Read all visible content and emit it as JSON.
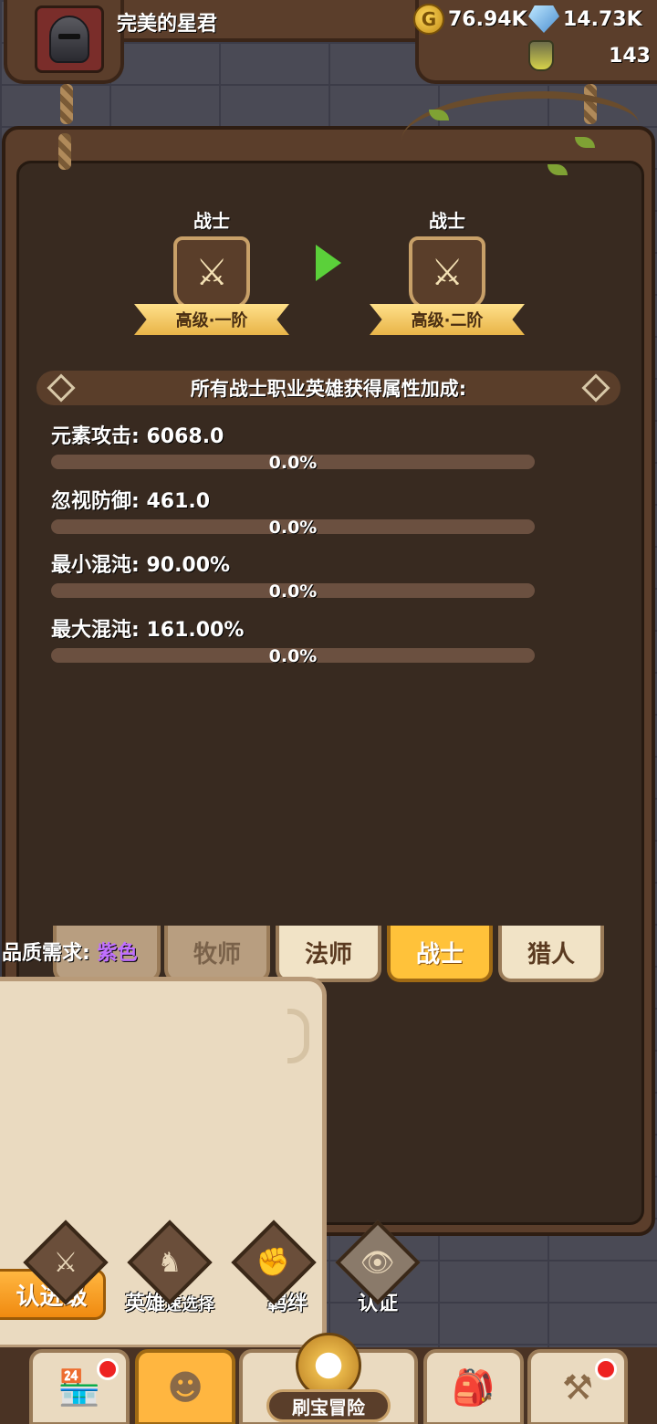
{
  "player": {
    "name": "完美的星君"
  },
  "resources": {
    "gold": "76.94K",
    "gems": "14.73K",
    "potion": "143"
  },
  "upgrade": {
    "from": {
      "class_name": "战士",
      "rank": "高级·一阶"
    },
    "to": {
      "class_name": "战士",
      "rank": "高级·二阶"
    }
  },
  "bonus": {
    "title": "所有战士职业英雄获得属性加成:",
    "stats": [
      {
        "label": "元素攻击: 6068.0",
        "percent": "0.0%"
      },
      {
        "label": "忽视防御: 461.0",
        "percent": "0.0%"
      },
      {
        "label": "最小混沌: 90.00%",
        "percent": "0.0%"
      },
      {
        "label": "最大混沌: 161.00%",
        "percent": "0.0%"
      }
    ]
  },
  "quality": {
    "label": "品质需求:",
    "value": "紫色"
  },
  "tabs": [
    "牧师",
    "法师",
    "战士",
    "猎人"
  ],
  "actions": {
    "upgrade_btn": "认进级",
    "hero_label": "英雄",
    "quick_select": "速选择",
    "bond_label": "羁绊",
    "cert_label": "认证"
  },
  "nav": {
    "center_label": "刷宝冒险"
  },
  "icons": [
    "coin-icon",
    "gem-icon",
    "potion-icon",
    "sword-icon",
    "shop-icon",
    "hero-icon",
    "compass-icon",
    "bag-icon",
    "forge-icon"
  ],
  "colors": {
    "accent": "#ffc23a",
    "purple": "#c070ff",
    "panel": "#382a20"
  }
}
